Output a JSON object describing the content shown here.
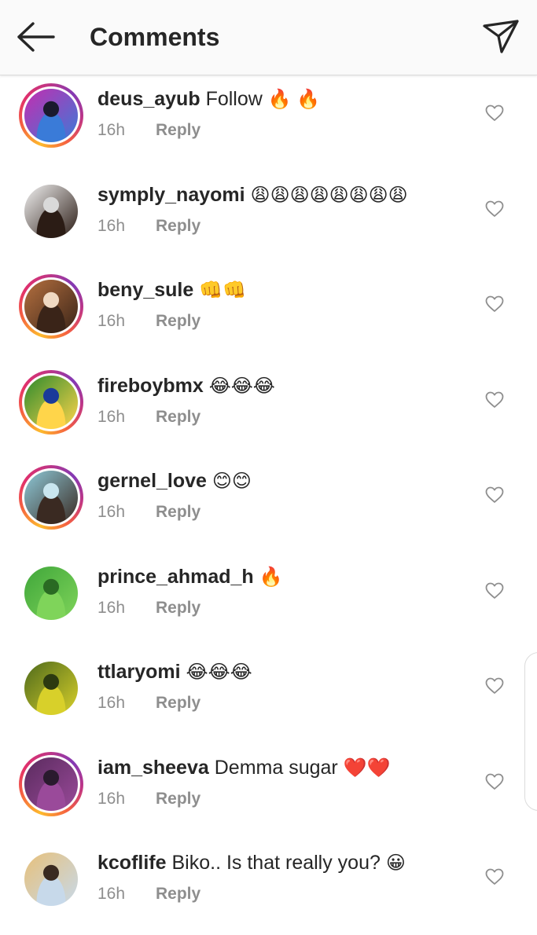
{
  "header": {
    "title": "Comments"
  },
  "comments": [
    {
      "username": "deus_ayub",
      "text": "Follow",
      "emoji": "🔥 🔥",
      "time": "16h",
      "reply": "Reply",
      "story": true,
      "colors": [
        "#c42db0",
        "#3a7bd8",
        "#1a1a2e"
      ]
    },
    {
      "username": "symply_nayomi",
      "text": "",
      "emoji": "😩😩😩😩😩😩😩😩",
      "time": "16h",
      "reply": "Reply",
      "story": false,
      "colors": [
        "#f2f2f2",
        "#2b1c15",
        "#d9d9d9"
      ]
    },
    {
      "username": "beny_sule",
      "text": "",
      "emoji": "👊👊",
      "time": "16h",
      "reply": "Reply",
      "story": true,
      "colors": [
        "#b5703f",
        "#3a2418",
        "#f0d9c2"
      ]
    },
    {
      "username": "fireboybmx",
      "text": "",
      "emoji": "😂😂😂",
      "time": "16h",
      "reply": "Reply",
      "story": true,
      "colors": [
        "#2d8a2d",
        "#ffd54a",
        "#1a3a9a"
      ]
    },
    {
      "username": "gernel_love",
      "text": "",
      "emoji": "😊😊",
      "time": "16h",
      "reply": "Reply",
      "story": true,
      "colors": [
        "#8ec9d8",
        "#3a2a22",
        "#c9e6ef"
      ]
    },
    {
      "username": "prince_ahmad_h",
      "text": "",
      "emoji": "🔥",
      "time": "16h",
      "reply": "Reply",
      "story": false,
      "colors": [
        "#3fa63a",
        "#7fd45a",
        "#2a6a23"
      ]
    },
    {
      "username": "ttlaryomi",
      "text": "",
      "emoji": "😂😂😂",
      "time": "16h",
      "reply": "Reply",
      "story": false,
      "colors": [
        "#4e6a1c",
        "#d8d02a",
        "#2c3a10"
      ]
    },
    {
      "username": "iam_sheeva",
      "text": "Demma sugar",
      "emoji": "❤️❤️",
      "time": "16h",
      "reply": "Reply",
      "story": true,
      "colors": [
        "#5a2b5e",
        "#9a4a9a",
        "#2a1a2e"
      ]
    },
    {
      "username": "kcoflife",
      "text": "Biko.. Is that really you?",
      "emoji": "😀",
      "time": "16h",
      "reply": "Reply",
      "story": false,
      "colors": [
        "#e7c07a",
        "#c7d9ea",
        "#3a2a20"
      ]
    }
  ]
}
